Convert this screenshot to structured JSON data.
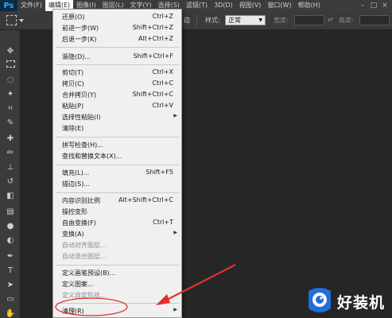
{
  "app": {
    "logo": "Ps"
  },
  "menubar": {
    "items": [
      "文件(F)",
      "编辑(E)",
      "图像(I)",
      "图层(L)",
      "文字(Y)",
      "选择(S)",
      "滤镜(T)",
      "3D(D)",
      "视图(V)",
      "窗口(W)",
      "帮助(H)"
    ],
    "active_index": 1
  },
  "options_bar": {
    "partial_label": "边",
    "style_label": "样式:",
    "style_value": "正常",
    "width_label": "宽度:",
    "height_label": "高度:"
  },
  "edit_menu": {
    "items": [
      {
        "label": "还原(O)",
        "shortcut": "Ctrl+Z"
      },
      {
        "label": "前进一步(W)",
        "shortcut": "Shift+Ctrl+Z"
      },
      {
        "label": "后退一步(K)",
        "shortcut": "Alt+Ctrl+Z"
      },
      {
        "label": "渐隐(D)...",
        "shortcut": "Shift+Ctrl+F"
      },
      {
        "label": "剪切(T)",
        "shortcut": "Ctrl+X"
      },
      {
        "label": "拷贝(C)",
        "shortcut": "Ctrl+C"
      },
      {
        "label": "合并拷贝(Y)",
        "shortcut": "Shift+Ctrl+C"
      },
      {
        "label": "粘贴(P)",
        "shortcut": "Ctrl+V"
      },
      {
        "label": "选择性粘贴(I)",
        "shortcut": ""
      },
      {
        "label": "清除(E)",
        "shortcut": ""
      },
      {
        "label": "拼写检查(H)...",
        "shortcut": ""
      },
      {
        "label": "查找和替换文本(X)...",
        "shortcut": ""
      },
      {
        "label": "填充(L)...",
        "shortcut": "Shift+F5"
      },
      {
        "label": "描边(S)...",
        "shortcut": ""
      },
      {
        "label": "内容识别比例",
        "shortcut": "Alt+Shift+Ctrl+C"
      },
      {
        "label": "操控变形",
        "shortcut": ""
      },
      {
        "label": "自由变换(F)",
        "shortcut": "Ctrl+T"
      },
      {
        "label": "变换(A)",
        "shortcut": ""
      },
      {
        "label": "自动对齐图层...",
        "shortcut": ""
      },
      {
        "label": "自动混合图层...",
        "shortcut": ""
      },
      {
        "label": "定义画笔预设(B)...",
        "shortcut": ""
      },
      {
        "label": "定义图案...",
        "shortcut": ""
      },
      {
        "label": "定义自定形状...",
        "shortcut": ""
      },
      {
        "label": "清理(R)",
        "shortcut": ""
      }
    ]
  },
  "watermark": {
    "text": "好装机"
  },
  "colors": {
    "menu_bg": "#f0f0f0",
    "annotation_red": "#e0302a",
    "ps_blue": "#2fa8ff",
    "watermark_blue": "#1e6fd6"
  }
}
